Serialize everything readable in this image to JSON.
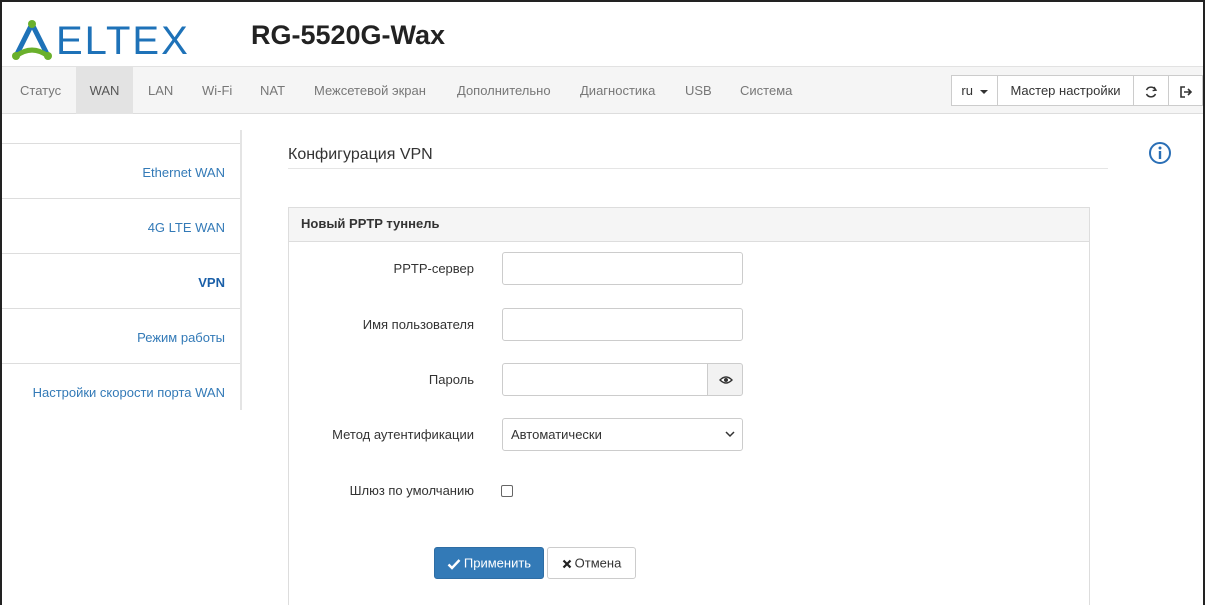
{
  "header": {
    "logo_text": "ELTEX",
    "device_name": "RG-5520G-Wax"
  },
  "colors": {
    "accent": "#337ab7",
    "logo_green": "#6ab02c",
    "logo_blue": "#1e72b8",
    "info_icon": "#2a6fb6"
  },
  "nav": {
    "items": [
      {
        "label": "Статус"
      },
      {
        "label": "WAN",
        "active": true
      },
      {
        "label": "LAN"
      },
      {
        "label": "Wi-Fi"
      },
      {
        "label": "NAT"
      },
      {
        "label": "Межсетевой экран"
      },
      {
        "label": "Дополнительно"
      },
      {
        "label": "Диагностика"
      },
      {
        "label": "USB"
      },
      {
        "label": "Система"
      }
    ],
    "language": "ru",
    "language_icon": "caret-down-icon",
    "wizard_label": "Мастер настройки",
    "refresh_icon": "refresh-icon",
    "logout_icon": "logout-icon"
  },
  "sidebar": {
    "items": [
      {
        "label": "Ethernet WAN"
      },
      {
        "label": "4G LTE WAN"
      },
      {
        "label": "VPN",
        "active": true
      },
      {
        "label": "Режим работы"
      },
      {
        "label": "Настройки скорости порта WAN"
      }
    ]
  },
  "main": {
    "title": "Конфигурация VPN",
    "info_icon": "info-icon",
    "panel": {
      "title": "Новый PPTP туннель",
      "fields": {
        "server_label": "PPTP-сервер",
        "server_value": "",
        "username_label": "Имя пользователя",
        "username_value": "",
        "password_label": "Пароль",
        "password_value": "",
        "password_toggle_icon": "eye-icon",
        "auth_label": "Метод аутентификации",
        "auth_value": "Автоматически",
        "default_gw_label": "Шлюз по умолчанию",
        "default_gw_checked": false
      },
      "apply_label": "Применить",
      "cancel_label": "Отмена"
    }
  }
}
